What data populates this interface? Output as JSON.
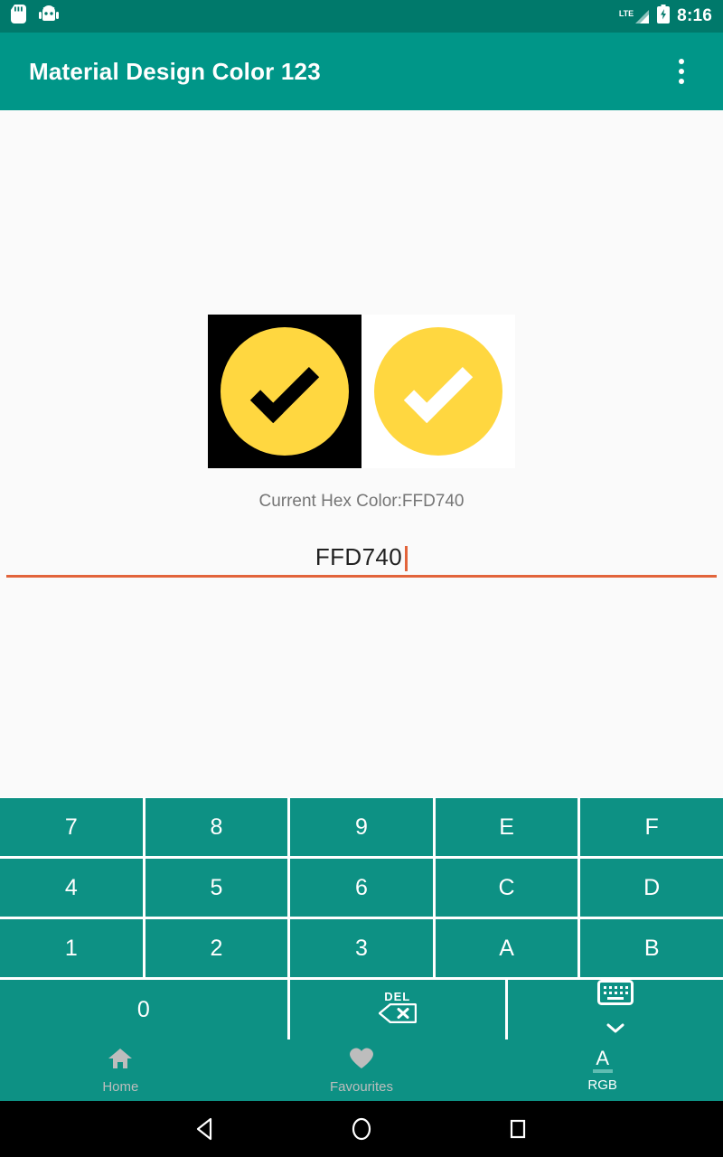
{
  "status_bar": {
    "time": "8:16",
    "network_label": "LTE",
    "icons": [
      "sd-card-icon",
      "android-head-icon",
      "lte-signal-icon",
      "battery-charging-icon"
    ]
  },
  "app_bar": {
    "title": "Material Design Color 123",
    "overflow_menu": "overflow-menu-icon",
    "background": "#009688"
  },
  "preview": {
    "dark_tile_background": "#000000",
    "light_tile_background": "#FFFFFF",
    "check_color": "#FFD740",
    "dark_check_mark_color": "#000000",
    "light_check_mark_color": "#FFFFFF"
  },
  "hex": {
    "caption": "Current Hex Color:FFD740",
    "input_value": "FFD740",
    "input_underline_color": "#E2643B",
    "caret_color": "#E2643B",
    "current_color": "#FFD740"
  },
  "keypad": {
    "background": "#0D9184",
    "rows": [
      [
        {
          "label": "7",
          "name": "key-7"
        },
        {
          "label": "8",
          "name": "key-8"
        },
        {
          "label": "9",
          "name": "key-9"
        },
        {
          "label": "E",
          "name": "key-e"
        },
        {
          "label": "F",
          "name": "key-f"
        }
      ],
      [
        {
          "label": "4",
          "name": "key-4"
        },
        {
          "label": "5",
          "name": "key-5"
        },
        {
          "label": "6",
          "name": "key-6"
        },
        {
          "label": "C",
          "name": "key-c"
        },
        {
          "label": "D",
          "name": "key-d"
        }
      ],
      [
        {
          "label": "1",
          "name": "key-1"
        },
        {
          "label": "2",
          "name": "key-2"
        },
        {
          "label": "3",
          "name": "key-3"
        },
        {
          "label": "A",
          "name": "key-a"
        },
        {
          "label": "B",
          "name": "key-b"
        }
      ]
    ],
    "zero_label": "0",
    "delete_label": "DEL",
    "hide_keyboard_icon": "keyboard-hide-icon"
  },
  "bottom_nav": {
    "items": [
      {
        "label": "Home",
        "icon": "home-icon",
        "active": false
      },
      {
        "label": "Favourites",
        "icon": "heart-icon",
        "active": false
      },
      {
        "label": "RGB",
        "icon": "text-format-icon",
        "active": true
      }
    ],
    "rgb_glyph_letter": "A"
  },
  "android_nav": {
    "back": "back-triangle-icon",
    "home": "home-circle-icon",
    "recents": "recents-square-icon"
  }
}
